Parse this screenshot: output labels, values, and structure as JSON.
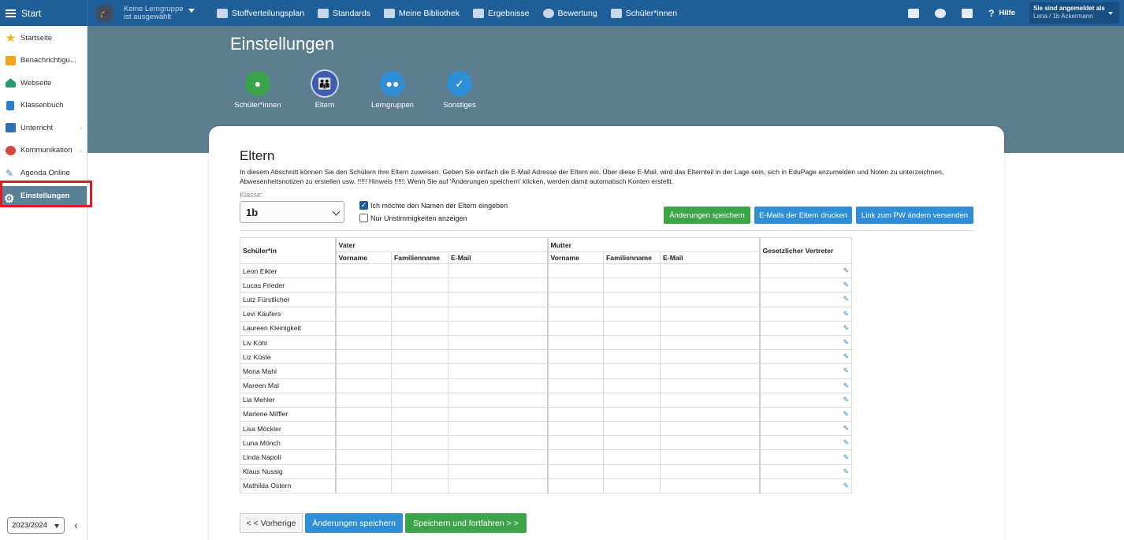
{
  "topbar": {
    "start_label": "Start",
    "group_line1": "Keine Lerngruppe",
    "group_line2": "ist ausgewählt",
    "nav": [
      {
        "label": "Stoffverteilungsplan",
        "icon": "calendar-icon"
      },
      {
        "label": "Standards",
        "icon": "shield-icon"
      },
      {
        "label": "Meine Bibliothek",
        "icon": "library-icon"
      },
      {
        "label": "Ergebnisse",
        "icon": "bar-chart-icon"
      },
      {
        "label": "Bewertung",
        "icon": "grade-icon"
      },
      {
        "label": "Schüler*innen",
        "icon": "students-icon"
      }
    ],
    "help_label": "Hilfe",
    "user_line1": "Sie sind angemeldet als",
    "user_line2": "Lena / 1b Ackermann"
  },
  "sidebar": {
    "items": [
      {
        "label": "Startseite",
        "color": "#f2b51f"
      },
      {
        "label": "Benachrichtigu...",
        "color": "#f2a31f"
      },
      {
        "label": "Webseite",
        "color": "#2a9b6e"
      },
      {
        "label": "Klassenbuch",
        "color": "#2f7fc8"
      },
      {
        "label": "Unterricht",
        "color": "#2f6fb5"
      },
      {
        "label": "Kommunikation",
        "color": "#d6463c"
      },
      {
        "label": "Agenda Online",
        "color": "#3a87c7"
      },
      {
        "label": "Einstellungen",
        "color": "#ffffff"
      }
    ],
    "year": "2023/2024"
  },
  "hero": {
    "title": "Einstellungen",
    "steps": [
      {
        "label": "Schüler*innen",
        "color": "#3aa44a"
      },
      {
        "label": "Eltern",
        "color": "#3f5cb0"
      },
      {
        "label": "Lerngruppen",
        "color": "#2f8fd6"
      },
      {
        "label": "Sonstiges",
        "color": "#2f8fd6"
      }
    ]
  },
  "card": {
    "title": "Eltern",
    "description": "In diesem Abschnitt können Sie den Schülern ihre Eltern zuweisen. Geben Sie einfach die E-Mail Adresse der Eltern ein. Über diese E-Mail, wird das Elternteil in der Lage sein, sich in EduPage anzumelden und Noten zu unterzeichnen, Abwesenheitsnotizen zu erstellen usw. !!!!! Hinweis !!!!!: Wenn Sie auf 'Änderungen speichern' klicken, werden damit automatisch Konten erstellt.",
    "klasse_label": "Klasse:",
    "klasse_value": "1b",
    "check1": "Ich möchte den Namen der Eltern eingeben",
    "check2": "Nur Unstimmigkeiten anzeigen",
    "btn_save": "Änderungen speichern",
    "btn_print": "E-Mails der Eltern drucken",
    "btn_link": "Link zum PW ändern versenden"
  },
  "table": {
    "h_student": "Schüler*in",
    "h_father": "Vater",
    "h_mother": "Mutter",
    "h_guardian": "Gesetzlicher Vertreter",
    "h_first": "Vorname",
    "h_last": "Familienname",
    "h_email": "E-Mail",
    "rows": [
      "Leon Eikler",
      "Lucas Frieder",
      "Lutz Fürstlicher",
      "Levi Käufers",
      "Laureen Kleinigkeit",
      "Liv Köhl",
      "Liz Küste",
      "Mona Mahl",
      "Mareen Mal",
      "Lia Mehler",
      "Marlene Miffler",
      "Lisa Möckler",
      "Luna Mönch",
      "Linda Napoli",
      "Klaus Nussig",
      "Mathilda Ostern"
    ]
  },
  "bottom": {
    "prev": "< < Vorherige",
    "save": "Änderungen speichern",
    "save_next": "Speichern und fortfahren > >"
  }
}
